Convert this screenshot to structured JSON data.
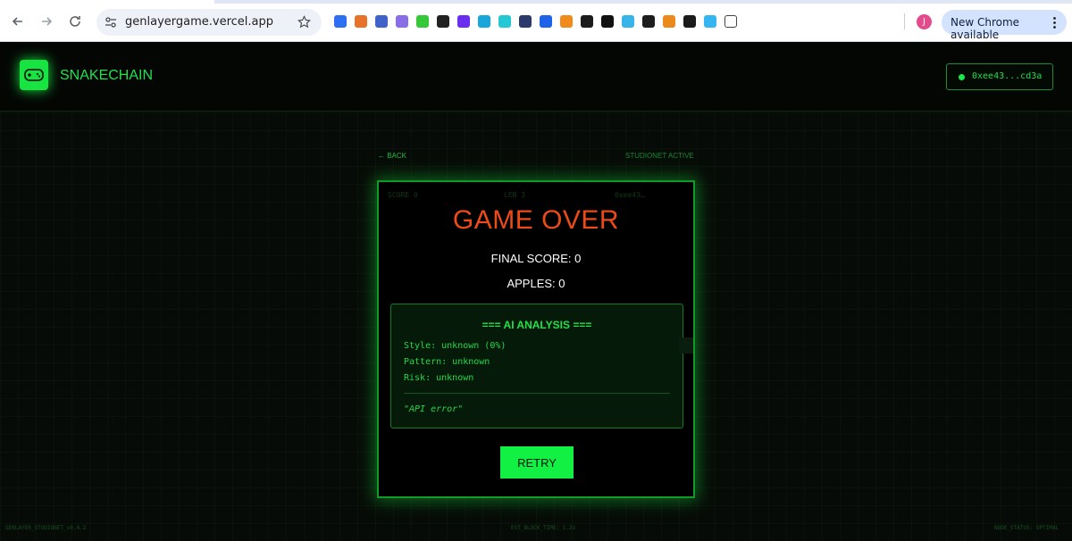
{
  "browser": {
    "url": "genlayergame.vercel.app",
    "profile_initial": "J",
    "update_label": "New Chrome available",
    "extensions": [
      "#2f6ff2",
      "#e9722b",
      "#3f63c9",
      "#8a6ee8",
      "#35c93a",
      "#222222",
      "#6a2ef0",
      "#19a6d9",
      "#24c7d4",
      "#2b3a6b",
      "#1f63e8",
      "#f08a1b",
      "#1c1c1c",
      "#111111",
      "#37b4e8",
      "#1d1d1d",
      "#e98a1b",
      "#1b1b1b",
      "#35b6f0"
    ]
  },
  "app": {
    "brand": "SNAKECHAIN",
    "wallet": "0xee43...cd3a",
    "accent": "#17e341"
  },
  "nav": {
    "back": "← BACK",
    "network": "STUDIONET ACTIVE"
  },
  "game": {
    "ghost_score": "SCORE 0",
    "ghost_len": "LEN 3",
    "ghost_addr": "0xee43…",
    "title": "GAME OVER",
    "final_score": "FINAL SCORE: 0",
    "apples": "APPLES: 0",
    "retry": "RETRY"
  },
  "analysis": {
    "title": "=== AI ANALYSIS ===",
    "style": "Style: unknown (0%)",
    "pattern": "Pattern: unknown",
    "risk": "Risk: unknown",
    "message": "\"API error\""
  },
  "footer": {
    "version": "GENLAYER_STUDIONET_v0.4.2",
    "block_time": "EST_BLOCK_TIME: 1.2s",
    "node_status": "NODE_STATUS: OPTIMAL"
  }
}
